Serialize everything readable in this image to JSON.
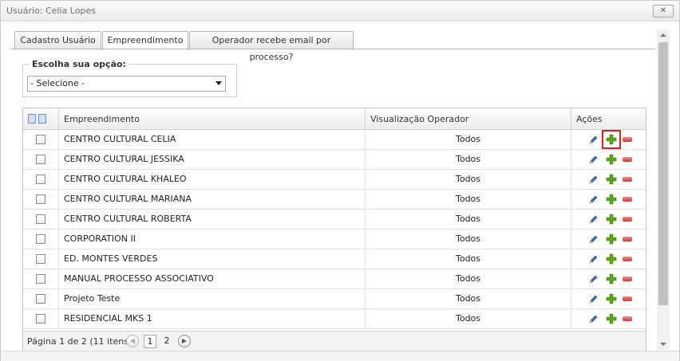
{
  "window": {
    "title": "Usuário: Celia Lopes",
    "close_label": "✕"
  },
  "tabs": [
    {
      "label": "Cadastro Usuário",
      "active": false
    },
    {
      "label": "Empreendimento",
      "active": true
    },
    {
      "label": "Operador recebe email por processo?",
      "active": false
    }
  ],
  "filter": {
    "legend": "Escolha sua opção:",
    "selected": "- Selecione -"
  },
  "grid": {
    "columns": [
      "Empreendimento",
      "Visualização Operador",
      "Ações"
    ],
    "rows": [
      {
        "name": "CENTRO CULTURAL CELIA",
        "visualizacao": "Todos"
      },
      {
        "name": "CENTRO CULTURAL JESSIKA",
        "visualizacao": "Todos"
      },
      {
        "name": "CENTRO CULTURAL KHALEO",
        "visualizacao": "Todos"
      },
      {
        "name": "CENTRO CULTURAL MARIANA",
        "visualizacao": "Todos"
      },
      {
        "name": "CENTRO CULTURAL ROBERTA",
        "visualizacao": "Todos"
      },
      {
        "name": "CORPORATION II",
        "visualizacao": "Todos"
      },
      {
        "name": "ED. MONTES VERDES",
        "visualizacao": "Todos"
      },
      {
        "name": "MANUAL PROCESSO ASSOCIATIVO",
        "visualizacao": "Todos"
      },
      {
        "name": "Projeto Teste",
        "visualizacao": "Todos"
      },
      {
        "name": "RESIDENCIAL MKS 1",
        "visualizacao": "Todos"
      }
    ]
  },
  "pager": {
    "summary": "Página 1 de 2 (11 itens)",
    "pages": [
      "1",
      "2"
    ],
    "prev_icon": "◀",
    "next_icon": "▶"
  },
  "colors": {
    "highlight": "#e02020",
    "add": "#5aa61a",
    "remove": "#d43838",
    "edit": "#3b6fb6"
  }
}
